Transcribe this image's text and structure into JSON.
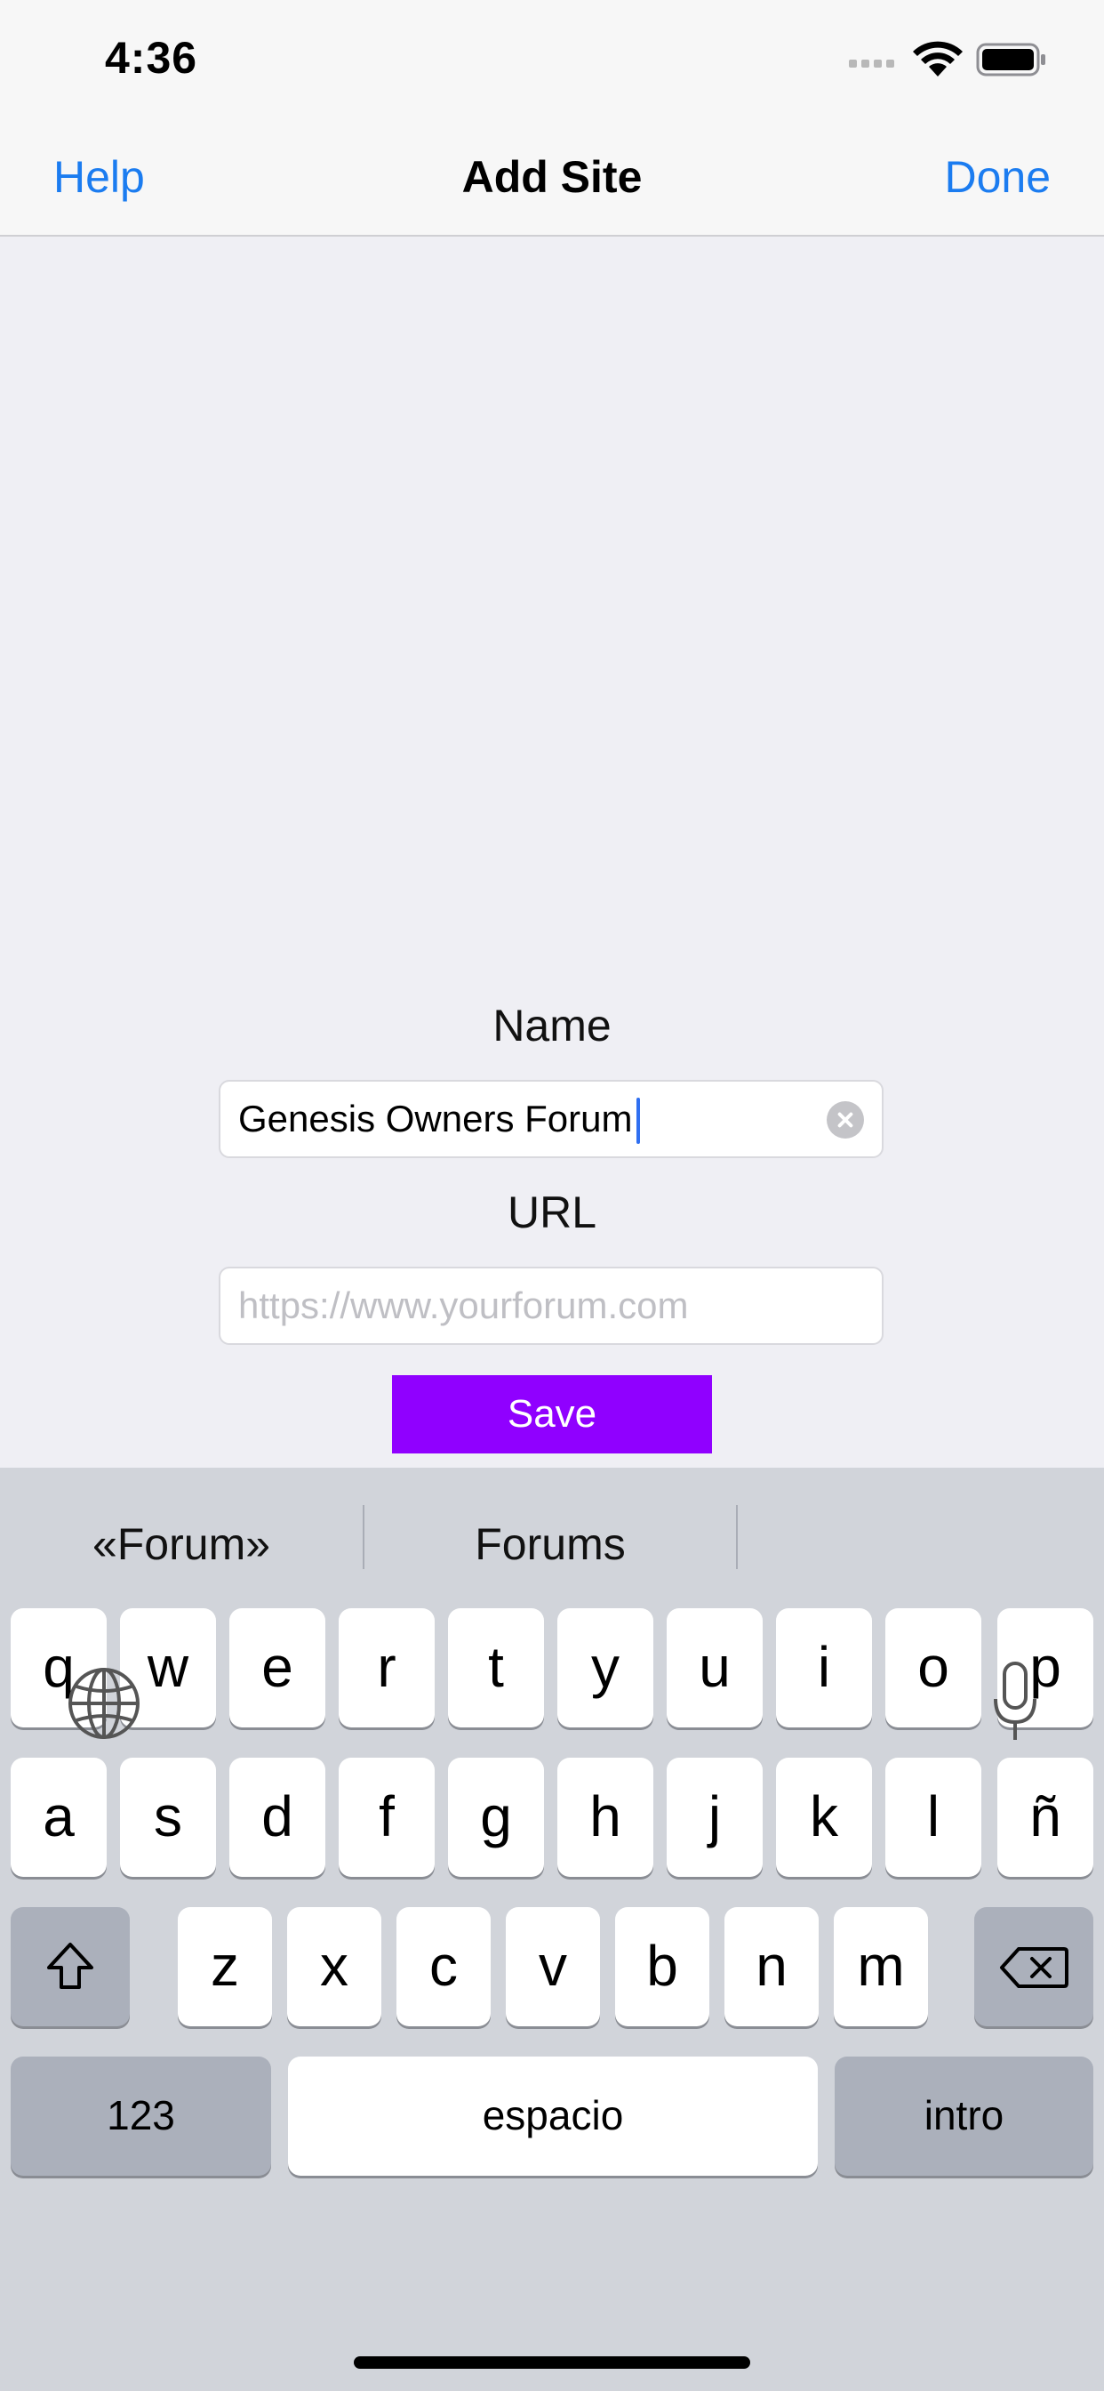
{
  "status_bar": {
    "time": "4:36"
  },
  "nav": {
    "left_label": "Help",
    "title": "Add Site",
    "right_label": "Done"
  },
  "form": {
    "name_label": "Name",
    "name_value": "Genesis Owners Forum",
    "url_label": "URL",
    "url_placeholder": "https://www.yourforum.com",
    "save_label": "Save"
  },
  "keyboard": {
    "suggestions": [
      "«Forum»",
      "Forums",
      ""
    ],
    "row1": [
      "q",
      "w",
      "e",
      "r",
      "t",
      "y",
      "u",
      "i",
      "o",
      "p"
    ],
    "row2": [
      "a",
      "s",
      "d",
      "f",
      "g",
      "h",
      "j",
      "k",
      "l",
      "ñ"
    ],
    "row3": [
      "z",
      "x",
      "c",
      "v",
      "b",
      "n",
      "m"
    ],
    "numbers_label": "123",
    "space_label": "espacio",
    "return_label": "intro"
  },
  "colors": {
    "accent": "#1b7cf0",
    "save_button": "#9000ff",
    "caret": "#2f6ff1"
  },
  "icons": [
    "signal-icon",
    "wifi-icon",
    "battery-icon",
    "clear-icon",
    "shift-icon",
    "delete-icon",
    "globe-icon",
    "microphone-icon"
  ]
}
